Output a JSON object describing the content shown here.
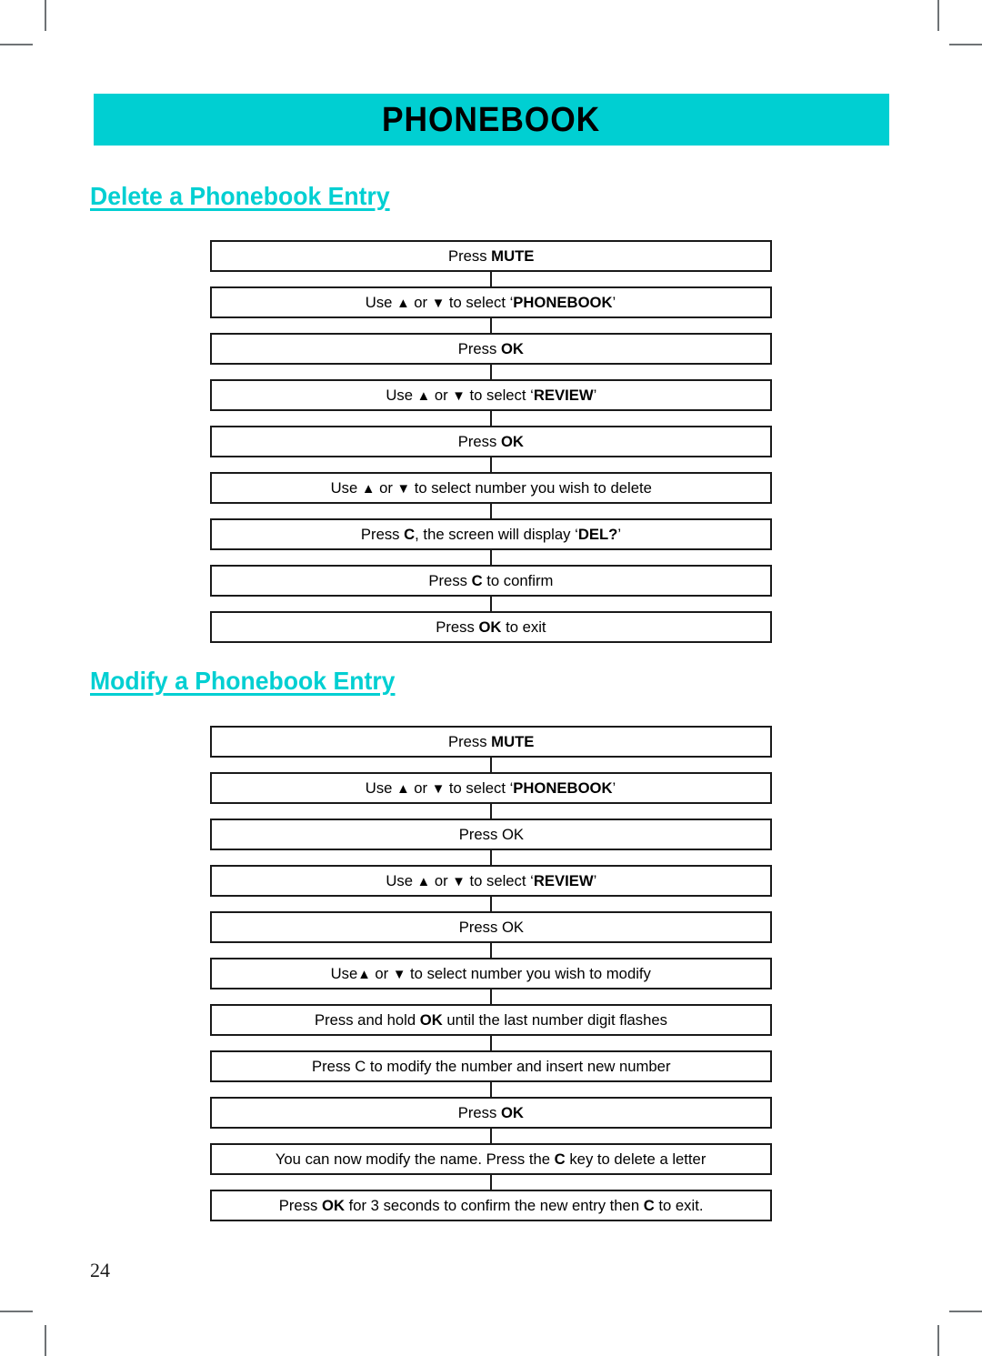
{
  "page": {
    "header_title": "PHONEBOOK",
    "page_number": "24",
    "accent_color": "#00CFD2",
    "text_color": "#000000",
    "border_color": "#1a1a1a",
    "background_color": "#ffffff"
  },
  "icons": {
    "up_arrow": "▲",
    "down_arrow": "▼"
  },
  "sections": [
    {
      "heading": "Delete a Phonebook Entry",
      "steps": [
        {
          "parts": [
            {
              "t": "Press ",
              "b": false
            },
            {
              "t": "MUTE",
              "b": true
            }
          ]
        },
        {
          "parts": [
            {
              "t": "Use ",
              "b": false
            },
            {
              "t": "▲",
              "b": false,
              "icon": "up-arrow-icon"
            },
            {
              "t": " or ",
              "b": false
            },
            {
              "t": "▼",
              "b": false,
              "icon": "down-arrow-icon"
            },
            {
              "t": "  to select ‘",
              "b": false
            },
            {
              "t": "PHONEBOOK",
              "b": true
            },
            {
              "t": "’",
              "b": false
            }
          ]
        },
        {
          "parts": [
            {
              "t": "Press ",
              "b": false
            },
            {
              "t": "OK",
              "b": true
            }
          ]
        },
        {
          "parts": [
            {
              "t": "Use ",
              "b": false
            },
            {
              "t": "▲",
              "b": false,
              "icon": "up-arrow-icon"
            },
            {
              "t": " or ",
              "b": false
            },
            {
              "t": "▼",
              "b": false,
              "icon": "down-arrow-icon"
            },
            {
              "t": " to select ‘",
              "b": false
            },
            {
              "t": "REVIEW",
              "b": true
            },
            {
              "t": "’",
              "b": false
            }
          ]
        },
        {
          "parts": [
            {
              "t": "Press ",
              "b": false
            },
            {
              "t": "OK",
              "b": true
            }
          ]
        },
        {
          "parts": [
            {
              "t": "Use ",
              "b": false
            },
            {
              "t": "▲",
              "b": false,
              "icon": "up-arrow-icon"
            },
            {
              "t": " or ",
              "b": false
            },
            {
              "t": "▼",
              "b": false,
              "icon": "down-arrow-icon"
            },
            {
              "t": "  to select number you wish to delete",
              "b": false
            }
          ]
        },
        {
          "parts": [
            {
              "t": "Press ",
              "b": false
            },
            {
              "t": "C",
              "b": true
            },
            {
              "t": ", the screen will display ‘",
              "b": false
            },
            {
              "t": "DEL?",
              "b": true
            },
            {
              "t": "’",
              "b": false
            }
          ]
        },
        {
          "parts": [
            {
              "t": "Press ",
              "b": false
            },
            {
              "t": "C",
              "b": true
            },
            {
              "t": " to confirm",
              "b": false
            }
          ]
        },
        {
          "parts": [
            {
              "t": "Press ",
              "b": false
            },
            {
              "t": "OK",
              "b": true
            },
            {
              "t": " to exit",
              "b": false
            }
          ]
        }
      ]
    },
    {
      "heading": "Modify a Phonebook Entry",
      "steps": [
        {
          "parts": [
            {
              "t": "Press ",
              "b": false
            },
            {
              "t": "MUTE",
              "b": true
            }
          ]
        },
        {
          "parts": [
            {
              "t": "Use ",
              "b": false
            },
            {
              "t": "▲",
              "b": false,
              "icon": "up-arrow-icon"
            },
            {
              "t": " or ",
              "b": false
            },
            {
              "t": "▼",
              "b": false,
              "icon": "down-arrow-icon"
            },
            {
              "t": " to select ‘",
              "b": false
            },
            {
              "t": "PHONEBOOK",
              "b": true
            },
            {
              "t": "’",
              "b": false
            }
          ]
        },
        {
          "parts": [
            {
              "t": "Press OK",
              "b": false
            }
          ]
        },
        {
          "parts": [
            {
              "t": "Use ",
              "b": false
            },
            {
              "t": "▲",
              "b": false,
              "icon": "up-arrow-icon"
            },
            {
              "t": " or ",
              "b": false
            },
            {
              "t": "▼",
              "b": false,
              "icon": "down-arrow-icon"
            },
            {
              "t": "  to select ‘",
              "b": false
            },
            {
              "t": "REVIEW",
              "b": true
            },
            {
              "t": "’",
              "b": false
            }
          ]
        },
        {
          "parts": [
            {
              "t": "Press OK",
              "b": false
            }
          ]
        },
        {
          "parts": [
            {
              "t": "Use",
              "b": false
            },
            {
              "t": "▲",
              "b": false,
              "icon": "up-arrow-icon"
            },
            {
              "t": " or ",
              "b": false
            },
            {
              "t": "▼",
              "b": false,
              "icon": "down-arrow-icon"
            },
            {
              "t": " to select number you wish to modify",
              "b": false
            }
          ]
        },
        {
          "parts": [
            {
              "t": "Press and hold ",
              "b": false
            },
            {
              "t": "OK",
              "b": true
            },
            {
              "t": " until the last number digit flashes",
              "b": false
            }
          ]
        },
        {
          "parts": [
            {
              "t": "Press C to modify the number and insert new number",
              "b": false
            }
          ]
        },
        {
          "parts": [
            {
              "t": "Press ",
              "b": false
            },
            {
              "t": "OK",
              "b": true
            }
          ]
        },
        {
          "parts": [
            {
              "t": "You can now modify the name. Press the ",
              "b": false
            },
            {
              "t": "C",
              "b": true
            },
            {
              "t": " key to delete a letter",
              "b": false
            }
          ]
        },
        {
          "parts": [
            {
              "t": "Press ",
              "b": false
            },
            {
              "t": "OK",
              "b": true
            },
            {
              "t": " for 3 seconds to confirm the new entry then ",
              "b": false
            },
            {
              "t": "C",
              "b": true
            },
            {
              "t": " to exit.",
              "b": false
            }
          ]
        }
      ]
    }
  ]
}
